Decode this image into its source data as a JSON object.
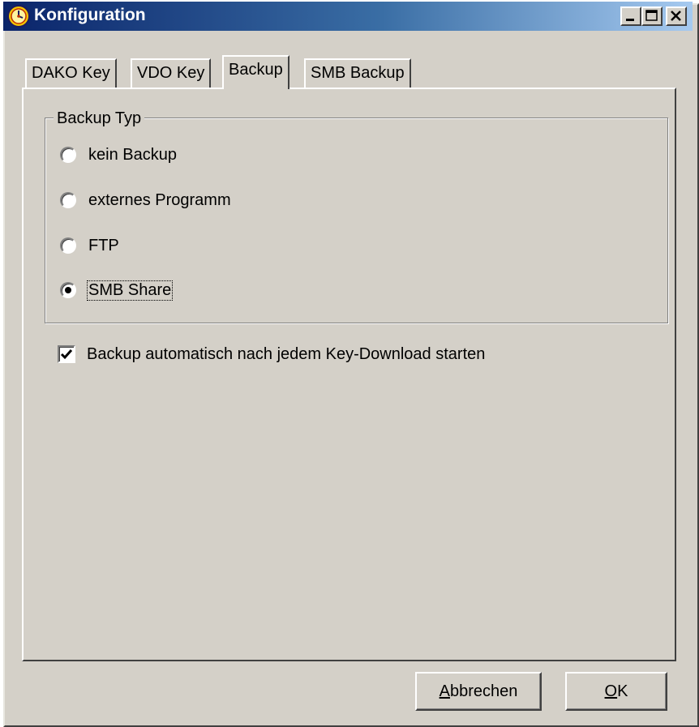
{
  "window": {
    "title": "Konfiguration",
    "icon": "tachograph-clock-icon",
    "caption_buttons": [
      "minimize-icon",
      "maximize-icon",
      "close-icon"
    ]
  },
  "tabs": [
    {
      "label": "DAKO Key",
      "active": false
    },
    {
      "label": "VDO Key",
      "active": false
    },
    {
      "label": "Backup",
      "active": true
    },
    {
      "label": "SMB Backup",
      "active": false
    }
  ],
  "backup_type": {
    "legend": "Backup Typ",
    "options": [
      {
        "label": "kein Backup",
        "selected": false
      },
      {
        "label": "externes Programm",
        "selected": false
      },
      {
        "label": "FTP",
        "selected": false
      },
      {
        "label": "SMB Share",
        "selected": true
      }
    ]
  },
  "auto_backup": {
    "label": "Backup automatisch nach jedem Key-Download starten",
    "checked": true
  },
  "buttons": {
    "cancel": {
      "mnemonic": "A",
      "rest": "bbrechen"
    },
    "ok": {
      "mnemonic": "O",
      "rest": "K"
    }
  },
  "colors": {
    "face": "#d4d0c8",
    "titlebar_start": "#0a246a",
    "titlebar_end": "#a6caf0"
  }
}
